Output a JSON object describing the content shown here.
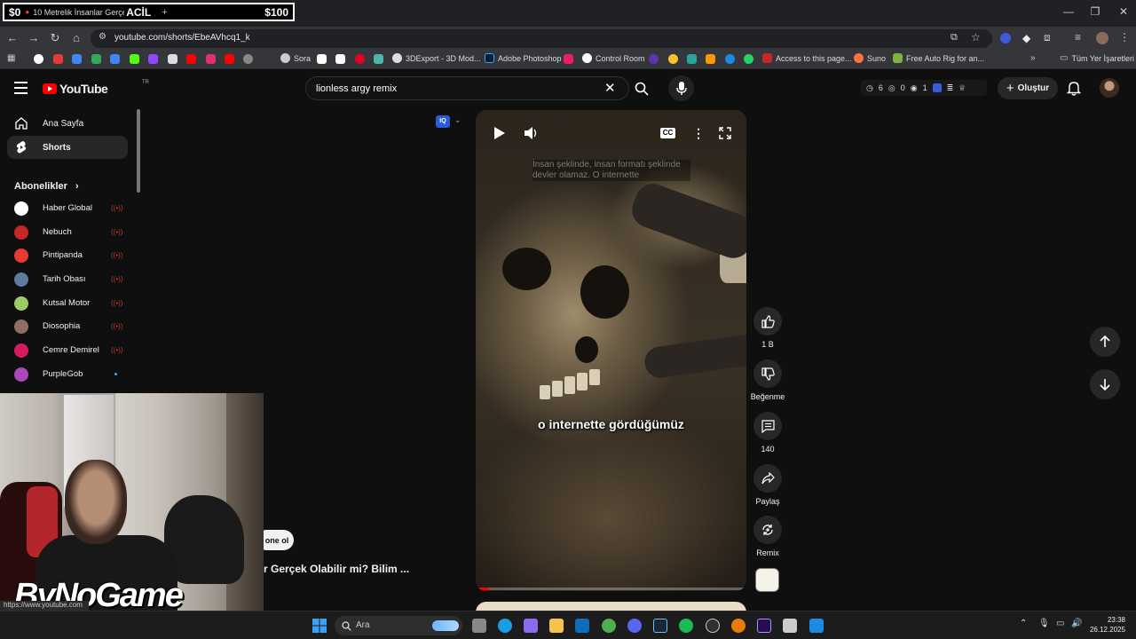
{
  "overlay": {
    "money_left": "$0",
    "tab_title": "10 Metrelik İnsanlar Gerçek Ol",
    "acil": "ACİL",
    "money_right": "$100"
  },
  "browser": {
    "url": "youtube.com/shorts/EbeAVhcq1_k",
    "bookmarks": [
      "Sora",
      "3DExport - 3D Mod...",
      "Adobe Photoshop",
      "Control Room",
      "Access to this page...",
      "Suno",
      "Free Auto Rig for an..."
    ],
    "all_bookmarks": "Tüm Yer İşaretleri"
  },
  "yt": {
    "logo": "YouTube",
    "logo_region": "TR",
    "search_query": "lionless argy remix",
    "ext_counts": [
      "6",
      "0",
      "1"
    ],
    "create_label": "Oluştur"
  },
  "sidebar": {
    "home": "Ana Sayfa",
    "shorts": "Shorts",
    "subscriptions_header": "Abonelikler",
    "subscriptions": [
      {
        "name": "Haber Global",
        "color": "#ffffff"
      },
      {
        "name": "Nebuch",
        "color": "#c62828"
      },
      {
        "name": "Pintipanda",
        "color": "#e53935"
      },
      {
        "name": "Tarih Obası",
        "color": "#5d7b9a"
      },
      {
        "name": "Kutsal Motor",
        "color": "#9ccc65"
      },
      {
        "name": "Diosophia",
        "color": "#8d6e63"
      },
      {
        "name": "Cemre Demirel",
        "color": "#d81b60"
      },
      {
        "name": "PurpleGob",
        "color": "#ab47bc"
      }
    ]
  },
  "short": {
    "caption_top": "İnsan şeklinde, insan formatı şeklinde devler olamaz. O internette",
    "caption_main": "o internette gördüğümüz",
    "progress": 0.05,
    "likes": "1 B",
    "dislike_label": "Beğenme",
    "comments": "140",
    "share_label": "Paylaş",
    "remix_label": "Remix",
    "cc": "CC",
    "iq": "IQ"
  },
  "behind_webcam": {
    "join_label": "one ol",
    "video_title": "r Gerçek Olabilir mi? Bilim ...",
    "brand": "ByNoGame"
  },
  "status_bar": {
    "url": "https://www.youtube.com"
  },
  "taskbar": {
    "search_placeholder": "Ara",
    "time": "23:38",
    "date": "26.12.2025"
  }
}
